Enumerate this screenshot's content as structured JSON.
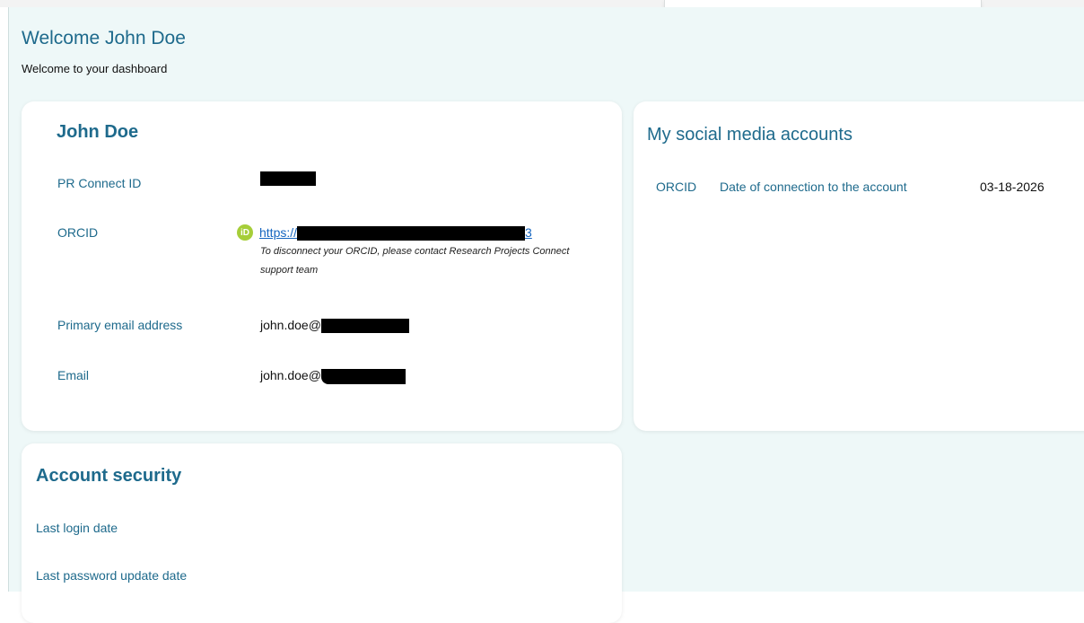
{
  "header": {
    "title": "Welcome John Doe",
    "subtitle": "Welcome to your dashboard"
  },
  "profile": {
    "name": "John Doe",
    "fields": {
      "pr_connect_id": {
        "label": "PR Connect ID"
      },
      "orcid": {
        "label": "ORCID",
        "badge": "iD",
        "link_prefix": "https://",
        "link_suffix": "3",
        "note": "To disconnect your ORCID, please contact Research Projects Connect support team"
      },
      "primary_email": {
        "label": "Primary email address",
        "value_prefix": "john.doe@"
      },
      "email": {
        "label": "Email",
        "value_prefix": "john.doe@"
      }
    }
  },
  "social": {
    "title": "My social media accounts",
    "rows": [
      {
        "account": "ORCID",
        "label": "Date of connection to the account",
        "date": "03-18-2026"
      }
    ]
  },
  "security": {
    "title": "Account security",
    "last_login_label": "Last login date",
    "last_password_label": "Last password update date"
  },
  "colors": {
    "accent": "#1e6a8c",
    "background": "#eef8f8",
    "card": "#ffffff",
    "orcid_green": "#a6ce39",
    "link": "#1565c0"
  }
}
